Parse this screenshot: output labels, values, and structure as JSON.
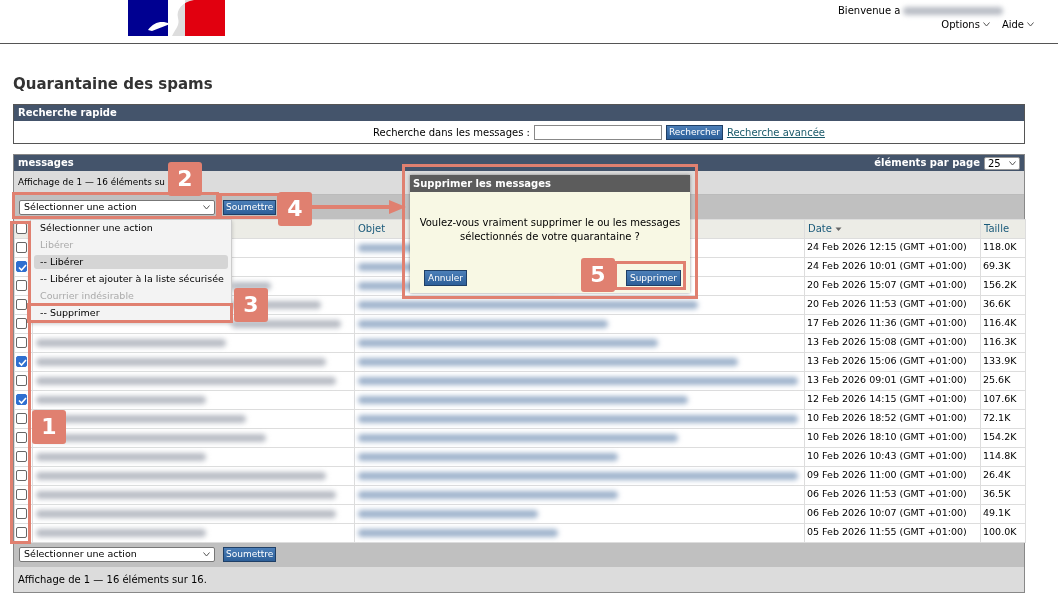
{
  "header": {
    "welcome": "Bienvenue a",
    "menus": [
      {
        "label": "Options"
      },
      {
        "label": "Aide"
      }
    ]
  },
  "page_title": "Quarantaine des spams",
  "quick_search": {
    "title": "Recherche rapide",
    "label": "Recherche dans les messages :",
    "button": "Rechercher",
    "advanced_link": "Recherche avancée"
  },
  "messages": {
    "title": "messages",
    "per_page_label": "éléments par page",
    "per_page": "25",
    "summary_top": "Affichage de 1 — 16 éléments su",
    "action_select": "Sélectionner une action",
    "submit": "Soumettre",
    "select_all_checked": false,
    "columns": [
      {
        "label": "Objet",
        "sorted": false
      },
      {
        "label": "Date",
        "sorted": true
      },
      {
        "label": "Taille",
        "sorted": false
      }
    ],
    "rows": [
      {
        "checked": false,
        "date": "24 Feb 2026 12:15 (GMT +01:00)",
        "size": "118.0K"
      },
      {
        "checked": true,
        "date": "24 Feb 2026 10:01 (GMT +01:00)",
        "size": "69.3K"
      },
      {
        "checked": false,
        "date": "20 Feb 2026 15:07 (GMT +01:00)",
        "size": "156.2K"
      },
      {
        "checked": false,
        "date": "20 Feb 2026 11:53 (GMT +01:00)",
        "size": "36.6K"
      },
      {
        "checked": false,
        "date": "17 Feb 2026 11:36 (GMT +01:00)",
        "size": "116.4K"
      },
      {
        "checked": false,
        "date": "13 Feb 2026 15:08 (GMT +01:00)",
        "size": "116.3K"
      },
      {
        "checked": true,
        "date": "13 Feb 2026 15:06 (GMT +01:00)",
        "size": "133.9K"
      },
      {
        "checked": false,
        "date": "13 Feb 2026 09:01 (GMT +01:00)",
        "size": "25.6K"
      },
      {
        "checked": true,
        "date": "12 Feb 2026 14:15 (GMT +01:00)",
        "size": "107.6K"
      },
      {
        "checked": false,
        "date": "10 Feb 2026 18:52 (GMT +01:00)",
        "size": "72.1K"
      },
      {
        "checked": false,
        "date": "10 Feb 2026 18:10 (GMT +01:00)",
        "size": "154.2K"
      },
      {
        "checked": false,
        "date": "10 Feb 2026 10:43 (GMT +01:00)",
        "size": "114.8K"
      },
      {
        "checked": false,
        "date": "09 Feb 2026 11:00 (GMT +01:00)",
        "size": "26.4K"
      },
      {
        "checked": false,
        "date": "06 Feb 2026 11:53 (GMT +01:00)",
        "size": "36.5K"
      },
      {
        "checked": false,
        "date": "06 Feb 2026 10:07 (GMT +01:00)",
        "size": "49.1K"
      },
      {
        "checked": false,
        "date": "05 Feb 2026 11:55 (GMT +01:00)",
        "size": "100.0K"
      }
    ],
    "bottom_action_select": "Sélectionner une action",
    "bottom_submit": "Soumettre",
    "summary_bottom": "Affichage de 1 — 16 éléments sur 16."
  },
  "action_menu": {
    "items": [
      {
        "label": "Sélectionner une action",
        "kind": "option",
        "selected": false
      },
      {
        "label": "Libérer",
        "kind": "group",
        "selected": false
      },
      {
        "label": "-- Libérer",
        "kind": "option",
        "selected": true
      },
      {
        "label": "-- Libérer et ajouter à la liste sécurisée",
        "kind": "option",
        "selected": false
      },
      {
        "label": "Courrier indésirable",
        "kind": "group",
        "selected": false
      },
      {
        "label": "-- Supprimer",
        "kind": "option",
        "selected": false
      }
    ]
  },
  "dialog": {
    "title": "Supprimer les messages",
    "message": "Voulez-vous vraiment supprimer le ou les messages sélectionnés de votre quarantaine ?",
    "buttons": [
      "Annuler",
      "Supprimer"
    ]
  },
  "annotations": [
    {
      "label": "1"
    },
    {
      "label": "2"
    },
    {
      "label": "3"
    },
    {
      "label": "4"
    },
    {
      "label": "5"
    }
  ]
}
